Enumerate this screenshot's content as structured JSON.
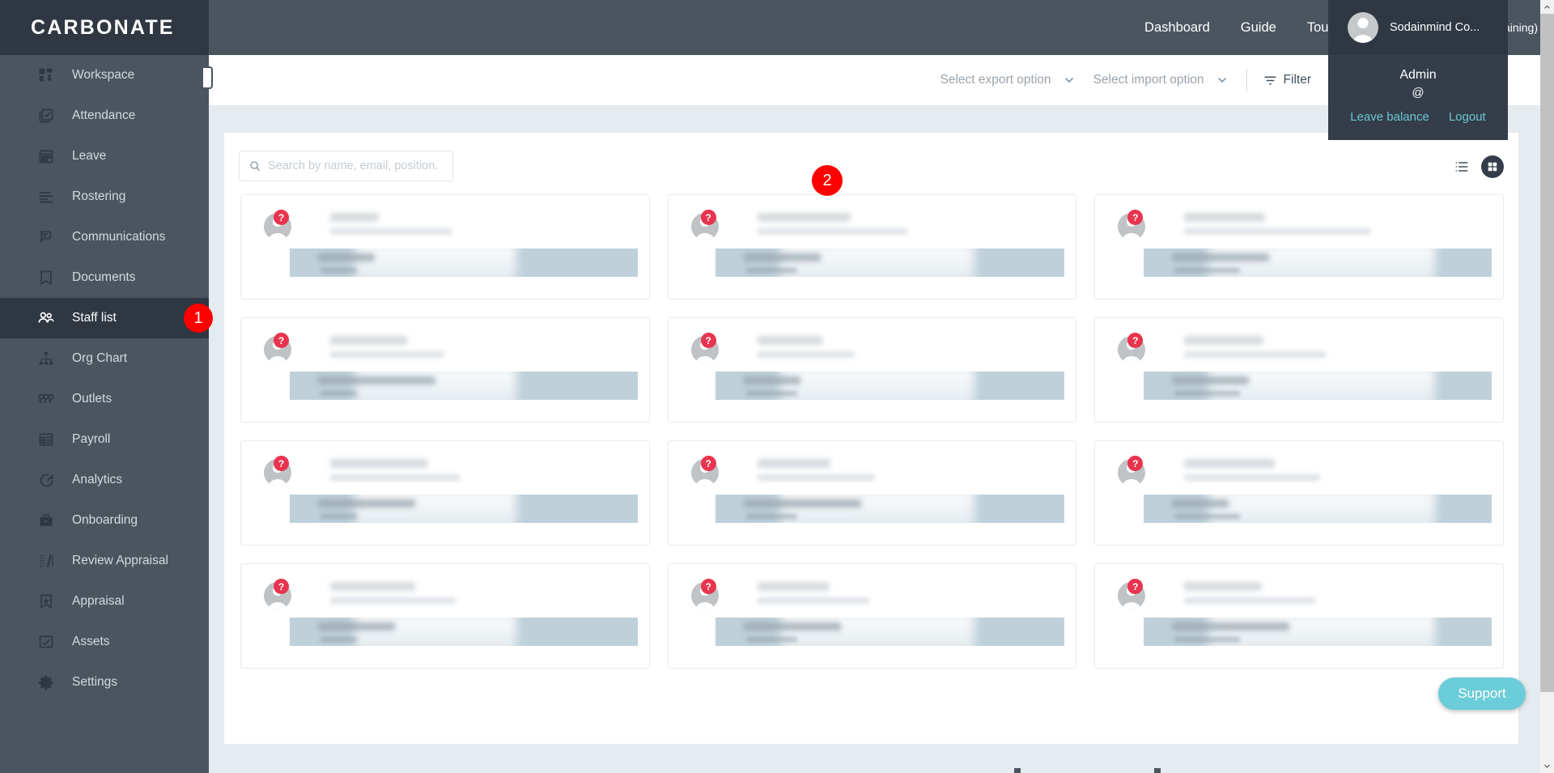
{
  "brand": {
    "name": "CARBONATE",
    "accent": "#6bcdd9",
    "sidebar_bg": "#4a5560",
    "header_bg": "#4a5560",
    "active_bg": "#2e3742",
    "badge_red": "#fe0000"
  },
  "sidebar": {
    "items": [
      {
        "label": "Workspace",
        "icon": "workspace-icon",
        "active": false
      },
      {
        "label": "Attendance",
        "icon": "attendance-icon",
        "active": false
      },
      {
        "label": "Leave",
        "icon": "calendar-icon",
        "active": false
      },
      {
        "label": "Rostering",
        "icon": "rostering-icon",
        "active": false
      },
      {
        "label": "Communications",
        "icon": "chat-icon",
        "active": false
      },
      {
        "label": "Documents",
        "icon": "document-icon",
        "active": false
      },
      {
        "label": "Staff list",
        "icon": "people-icon",
        "active": true
      },
      {
        "label": "Org Chart",
        "icon": "org-chart-icon",
        "active": false
      },
      {
        "label": "Outlets",
        "icon": "outlets-icon",
        "active": false
      },
      {
        "label": "Payroll",
        "icon": "payroll-icon",
        "active": false
      },
      {
        "label": "Analytics",
        "icon": "analytics-icon",
        "active": false
      },
      {
        "label": "Onboarding",
        "icon": "briefcase-icon",
        "active": false
      },
      {
        "label": "Review Appraisal",
        "icon": "review-appraisal-icon",
        "active": false
      },
      {
        "label": "Appraisal",
        "icon": "appraisal-icon",
        "active": false
      },
      {
        "label": "Assets",
        "icon": "assets-icon",
        "active": false
      },
      {
        "label": "Settings",
        "icon": "gear-icon",
        "active": false
      }
    ]
  },
  "header": {
    "links": [
      {
        "label": "Dashboard"
      },
      {
        "label": "Guide"
      },
      {
        "label": "Tour"
      }
    ],
    "trial_text": "(Expired trial days remaining)",
    "calendar_icon": "calendar-icon"
  },
  "user_menu": {
    "account_name": "Sodainmind Co...",
    "role": "Admin",
    "email": "@",
    "leave_balance_label": "Leave balance",
    "logout_label": "Logout",
    "avatar_icon": "avatar-icon"
  },
  "toolbar": {
    "export_label": "Select export option",
    "import_label": "Select import option",
    "filter_label": "Filter"
  },
  "search": {
    "placeholder": "Search by name, email, position.",
    "value": "",
    "icon": "search-icon"
  },
  "view_toggle": {
    "list_icon": "list-view-icon",
    "grid_icon": "grid-view-icon",
    "selected": "grid"
  },
  "staff_cards": [
    {
      "status": "?"
    },
    {
      "status": "?"
    },
    {
      "status": "?"
    },
    {
      "status": "?"
    },
    {
      "status": "?"
    },
    {
      "status": "?"
    },
    {
      "status": "?"
    },
    {
      "status": "?"
    },
    {
      "status": "?"
    },
    {
      "status": "?"
    },
    {
      "status": "?"
    },
    {
      "status": "?"
    }
  ],
  "annotations": [
    {
      "id": "1",
      "label": "1",
      "target": "sidebar-item-staff-list"
    },
    {
      "id": "2",
      "label": "2",
      "target": "staff-list-panel"
    }
  ],
  "support": {
    "label": "Support"
  },
  "scrollbar": {
    "up_arrow": "chevron-up-icon",
    "down_arrow": "chevron-down-icon"
  }
}
